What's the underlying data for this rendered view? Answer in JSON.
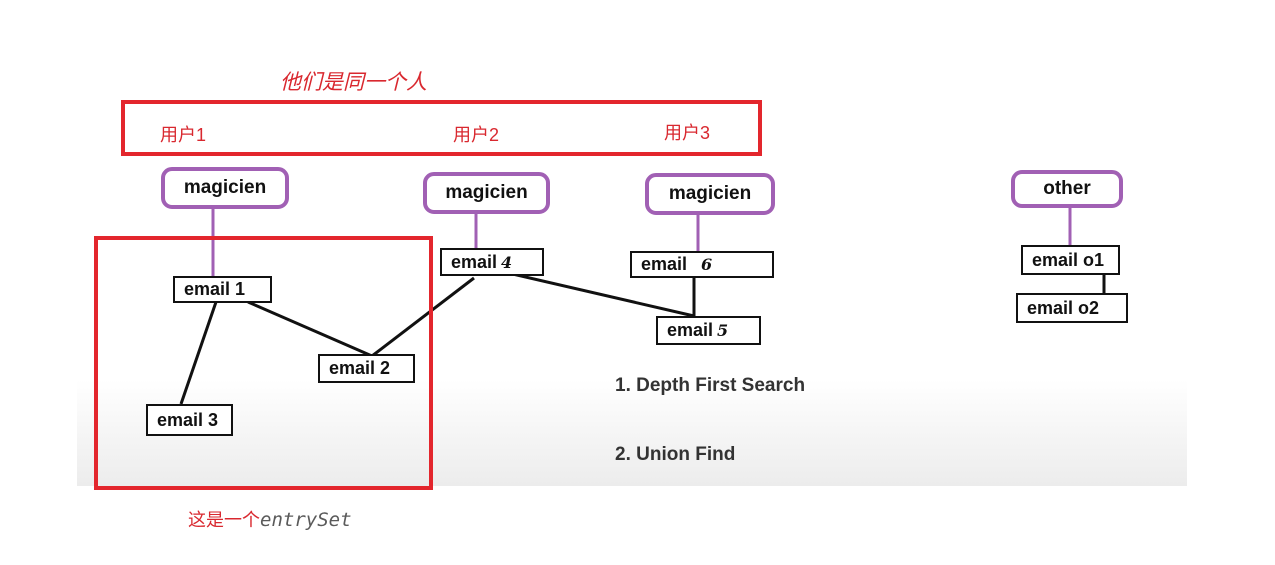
{
  "title": "他们是同一个人",
  "user_labels": [
    "用户1",
    "用户2",
    "用户3"
  ],
  "user_nodes": [
    "magicien",
    "magicien",
    "magicien",
    "other"
  ],
  "emails": {
    "e1": "email 1",
    "e2": "email 2",
    "e3": "email 3",
    "e4": {
      "prefix": "email",
      "num": "4"
    },
    "e5": {
      "prefix": "email",
      "num": "5"
    },
    "e6": {
      "prefix": "email",
      "num": "6"
    },
    "o1": "email o1",
    "o2": "email o2"
  },
  "methods": [
    "1. Depth First Search",
    "2. Union Find"
  ],
  "caption": {
    "prefix": "这是一个",
    "code": "entrySet"
  },
  "colors": {
    "user_border": "#a160b4",
    "highlight_red": "#e3262d",
    "edge": "#111111"
  }
}
